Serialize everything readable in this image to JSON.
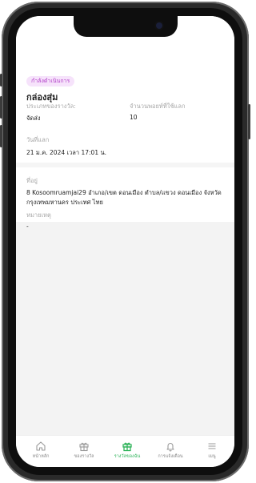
{
  "status_badge": "กำลังดำเนินการ",
  "title": "กล่องสุ่ม",
  "reward_type_label": "ประเภทของรางวัล:",
  "reward_type_value": "จัดส่ง",
  "points_label": "จำนวนพอยท์ที่ใช้แลก",
  "points_value": "10",
  "redeem_date_label": "วันที่แลก",
  "redeem_date_value": "21 ม.ค. 2024 เวลา 17:01 น.",
  "address_label": "ที่อยู่",
  "address_value": "8 Kosoomruamjai29 อำเภอ/เขต ดอนเมือง ตำบล/แขวง ดอนเมือง จังหวัด กรุงเทพมหานคร ประเทศ ไทย",
  "note_label": "หมายเหตุ",
  "note_value": "-",
  "colors": {
    "accent": "#2fb35a",
    "badge_bg": "#f6e3fb",
    "badge_text": "#b03cc7"
  },
  "tabs": [
    {
      "label": "หน้าหลัก",
      "icon": "home-icon"
    },
    {
      "label": "ของรางวัล",
      "icon": "gift-icon"
    },
    {
      "label": "รางวัลของฉัน",
      "icon": "my-reward-icon",
      "active": true
    },
    {
      "label": "การแจ้งเตือน",
      "icon": "bell-icon"
    },
    {
      "label": "เมนู",
      "icon": "menu-icon"
    }
  ]
}
